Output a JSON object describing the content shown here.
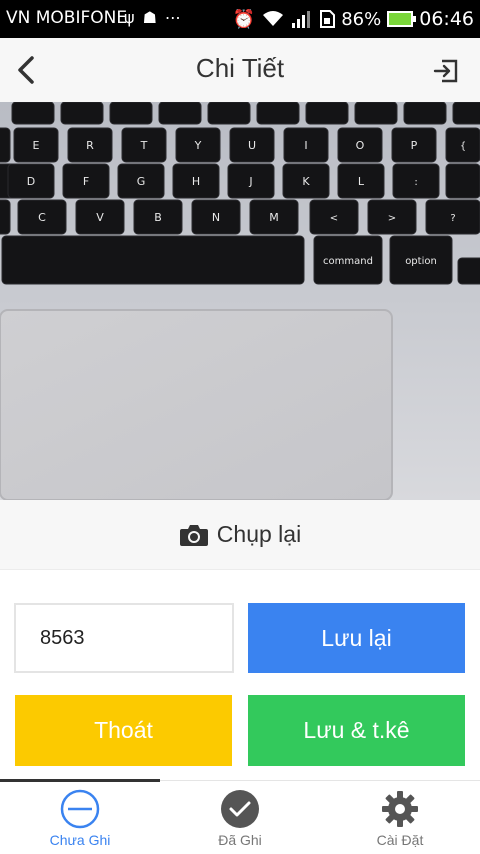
{
  "status_bar": {
    "carrier": "VN MOBIFONE",
    "left_icons": [
      "usb-icon",
      "android-icon",
      "more-icon"
    ],
    "right_icons": [
      "alarm-icon",
      "wifi-icon",
      "signal-icon",
      "sim-icon"
    ],
    "battery": "86%",
    "battery_color": "#7ad63a",
    "time": "06:46"
  },
  "header": {
    "title": "Chi Tiết",
    "back_icon": "chevron-left-icon",
    "exit_icon": "exit-icon"
  },
  "photo": {
    "keys_row1": [
      "E",
      "R",
      "T",
      "Y",
      "U",
      "I",
      "O",
      "P"
    ],
    "keys_row2": [
      "D",
      "F",
      "G",
      "H",
      "J",
      "K",
      "L"
    ],
    "keys_row3": [
      "C",
      "V",
      "B",
      "N",
      "M"
    ],
    "command_label": "command",
    "option_label": "option"
  },
  "retake": {
    "icon": "camera-icon",
    "label": "Chụp lại"
  },
  "form": {
    "value": "8563",
    "save_label": "Lưu lại",
    "exit_label": "Thoát",
    "save_next_label": "Lưu & t.kê",
    "colors": {
      "save": "#3a83f0",
      "exit": "#fcca00",
      "save_next": "#33c95c"
    }
  },
  "bottom_nav": {
    "items": [
      {
        "label": "Chưa Ghi",
        "icon": "minus-circle-icon",
        "active": true
      },
      {
        "label": "Đã Ghi",
        "icon": "check-circle-icon",
        "active": false
      },
      {
        "label": "Cài Đặt",
        "icon": "gear-icon",
        "active": false
      }
    ],
    "active_color": "#3a83f0"
  }
}
